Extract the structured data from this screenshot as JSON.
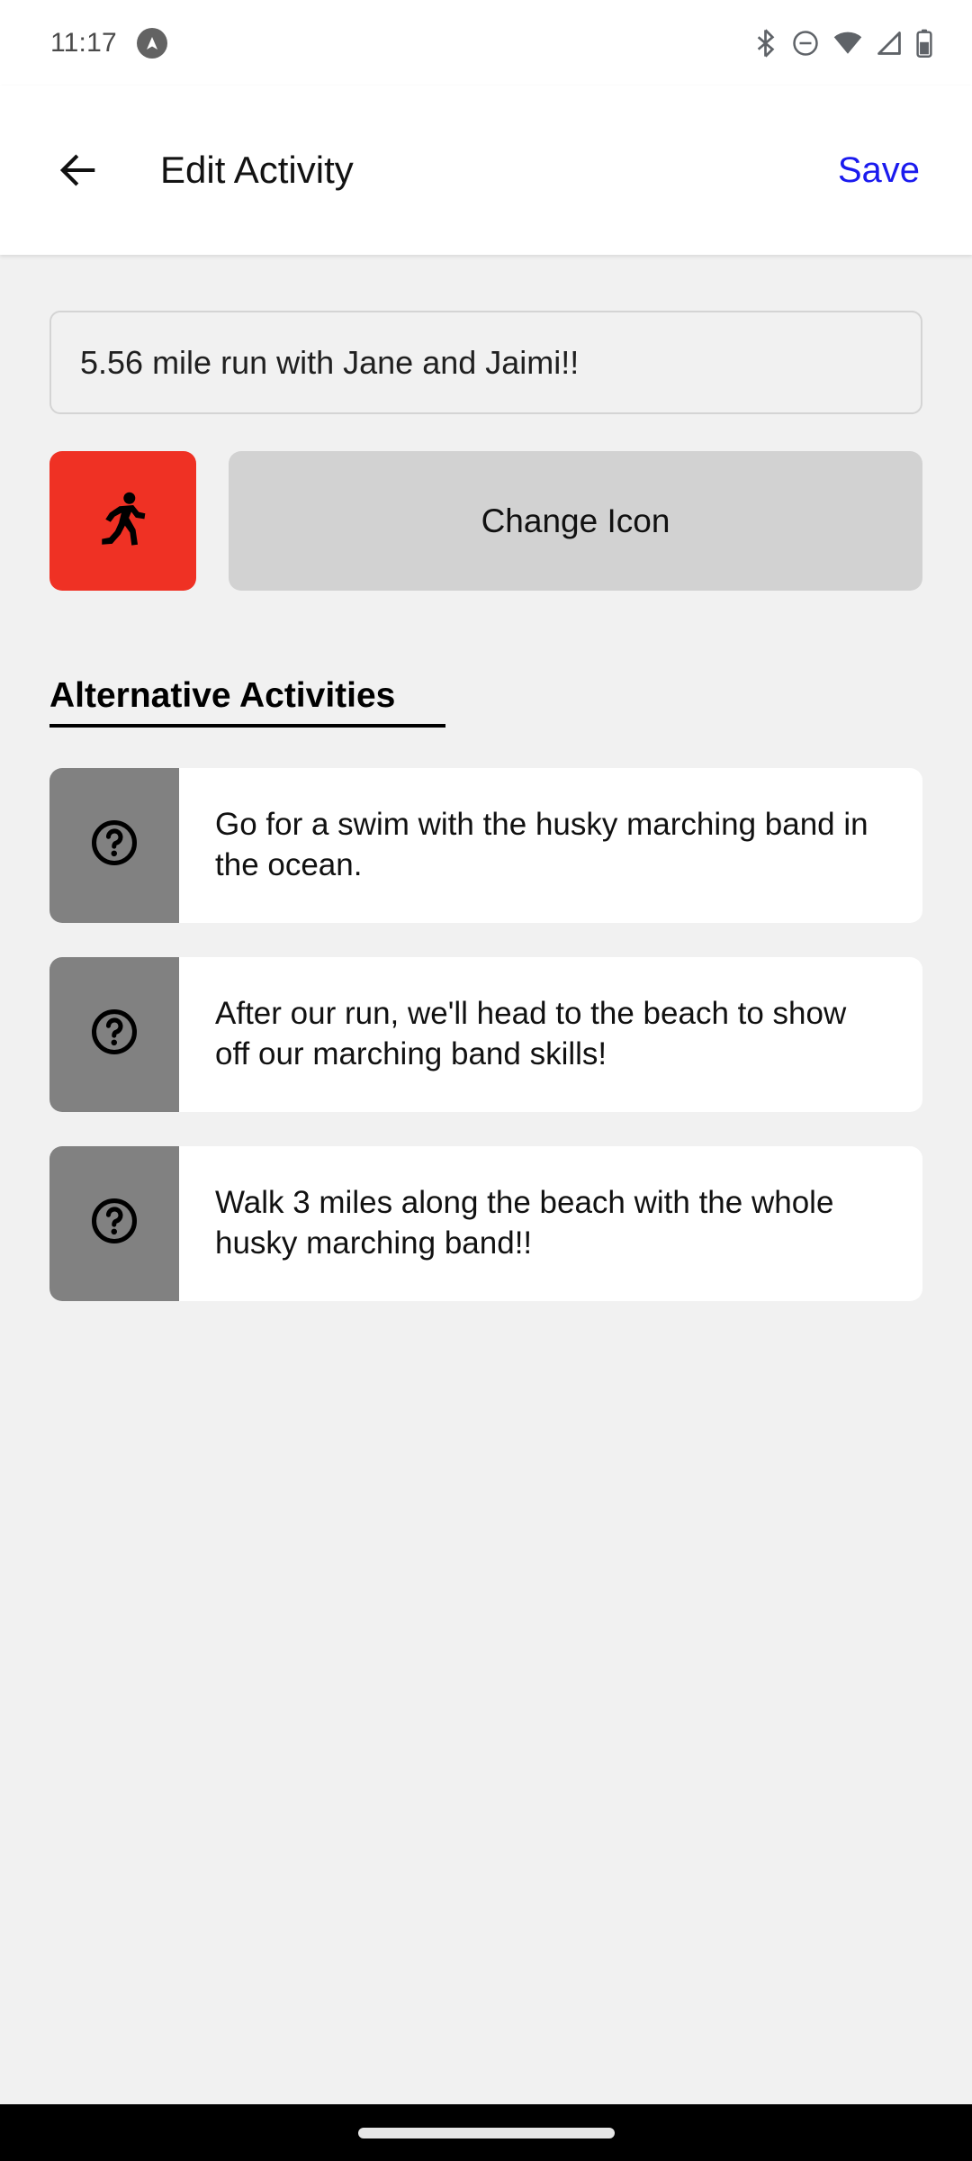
{
  "status_bar": {
    "time": "11:17",
    "app_badge_icon": "triangle-up-badge-icon",
    "icons": [
      "bluetooth-icon",
      "do-not-disturb-icon",
      "wifi-icon",
      "cellular-signal-icon",
      "battery-icon"
    ]
  },
  "app_bar": {
    "back_icon": "back-arrow-icon",
    "title": "Edit Activity",
    "save_label": "Save",
    "save_color": "#1a1aee"
  },
  "form": {
    "activity_title_value": "5.56 mile run with Jane and Jaimi!!",
    "activity_title_placeholder": "Activity title",
    "selected_icon": "running-person-icon",
    "selected_icon_color": "#ef3124",
    "change_icon_label": "Change Icon"
  },
  "alternatives": {
    "heading": "Alternative Activities",
    "items": [
      {
        "thumb_icon": "question-mark-circle-icon",
        "text": "Go for a swim with the husky marching band in the ocean."
      },
      {
        "thumb_icon": "question-mark-circle-icon",
        "text": "After our run, we'll head to the beach to show off our marching band skills!"
      },
      {
        "thumb_icon": "question-mark-circle-icon",
        "text": "Walk 3 miles along the beach with the whole husky marching band!!"
      }
    ]
  },
  "nav_bar": {
    "gesture_pill": "home-gesture-pill"
  }
}
